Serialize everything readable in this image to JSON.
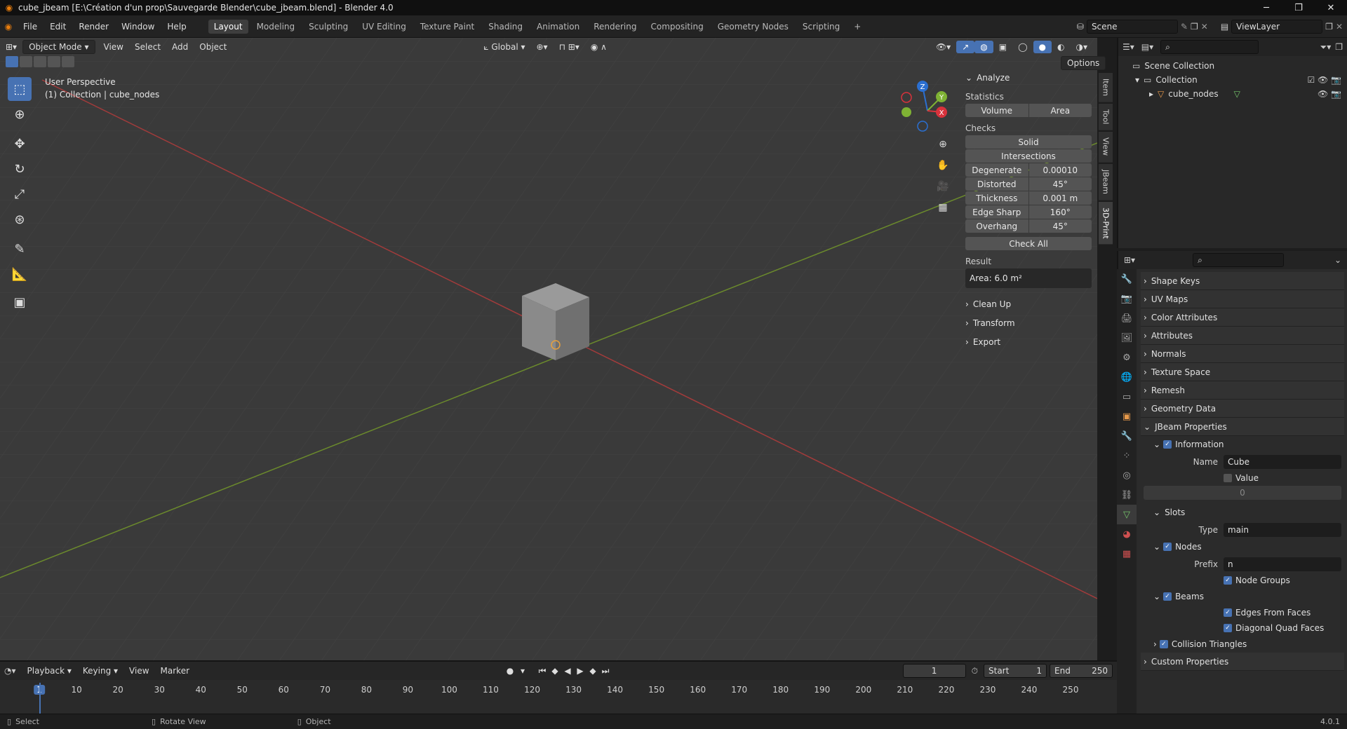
{
  "title": "cube_jbeam [E:\\Création d'un prop\\Sauvegarde Blender\\cube_jbeam.blend] - Blender 4.0",
  "menus": [
    "File",
    "Edit",
    "Render",
    "Window",
    "Help"
  ],
  "workspaces": [
    "Layout",
    "Modeling",
    "Sculpting",
    "UV Editing",
    "Texture Paint",
    "Shading",
    "Animation",
    "Rendering",
    "Compositing",
    "Geometry Nodes",
    "Scripting",
    "+"
  ],
  "scene": "Scene",
  "view_layer": "ViewLayer",
  "viewport": {
    "mode": "Object Mode",
    "menus": [
      "View",
      "Select",
      "Add",
      "Object"
    ],
    "orientation": "Global",
    "options": "Options",
    "perspective": "User Perspective",
    "collection_info": "(1) Collection | cube_nodes"
  },
  "gizmo": {
    "z": "Z",
    "y": "Y",
    "x": "X"
  },
  "npanel": {
    "tabs": [
      "Item",
      "Tool",
      "View",
      "JBeam",
      "3D-Print"
    ],
    "analyze": "Analyze",
    "statistics": "Statistics",
    "volume": "Volume",
    "area": "Area",
    "checks": "Checks",
    "solid": "Solid",
    "intersections": "Intersections",
    "rows": [
      {
        "k": "Degenerate",
        "v": "0.00010"
      },
      {
        "k": "Distorted",
        "v": "45°"
      },
      {
        "k": "Thickness",
        "v": "0.001 m"
      },
      {
        "k": "Edge Sharp",
        "v": "160°"
      },
      {
        "k": "Overhang",
        "v": "45°"
      }
    ],
    "check_all": "Check All",
    "result": "Result",
    "result_value": "Area: 6.0 m²",
    "collapsed": [
      "Clean Up",
      "Transform",
      "Export"
    ]
  },
  "outliner": {
    "scene_collection": "Scene Collection",
    "collection": "Collection",
    "object": "cube_nodes"
  },
  "props": {
    "panels": [
      "Shape Keys",
      "UV Maps",
      "Color Attributes",
      "Attributes",
      "Normals",
      "Texture Space",
      "Remesh",
      "Geometry Data"
    ],
    "jbeam": "JBeam Properties",
    "information": "Information",
    "name_label": "Name",
    "name_value": "Cube",
    "value_label": "Value",
    "value_num": "0",
    "slots": "Slots",
    "type_label": "Type",
    "type_value": "main",
    "nodes": "Nodes",
    "prefix_label": "Prefix",
    "prefix_value": "n",
    "node_groups": "Node Groups",
    "beams": "Beams",
    "edges_from_faces": "Edges From Faces",
    "diagonal_quad_faces": "Diagonal Quad Faces",
    "collision": "Collision Triangles",
    "custom": "Custom Properties"
  },
  "timeline": {
    "menus": [
      "Playback",
      "Keying",
      "View",
      "Marker"
    ],
    "current": "1",
    "start_label": "Start",
    "start": "1",
    "end_label": "End",
    "end": "250",
    "ticks": [
      "1",
      "10",
      "20",
      "30",
      "40",
      "50",
      "60",
      "70",
      "80",
      "90",
      "100",
      "110",
      "120",
      "130",
      "140",
      "150",
      "160",
      "170",
      "180",
      "190",
      "200",
      "210",
      "220",
      "230",
      "240",
      "250"
    ]
  },
  "status": {
    "select": "Select",
    "rotate": "Rotate View",
    "object": "Object",
    "version": "4.0.1"
  }
}
